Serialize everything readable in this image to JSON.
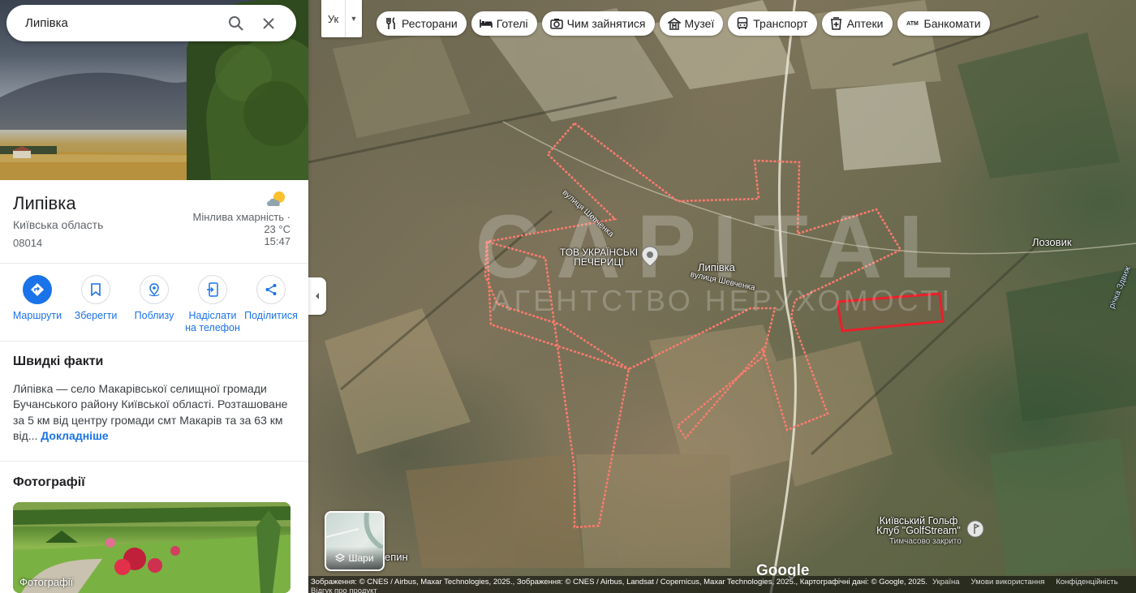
{
  "search": {
    "value": "Липівка"
  },
  "place": {
    "title": "Липівка",
    "region": "Київська область",
    "postal_code": "08014",
    "weather": {
      "condition": "Мінлива хмарність ·",
      "temperature": "23 °C",
      "time": "15:47"
    }
  },
  "actions": [
    {
      "label": "Маршрути",
      "icon": "directions-icon"
    },
    {
      "label": "Зберегти",
      "icon": "bookmark-icon"
    },
    {
      "label": "Поблизу",
      "icon": "nearby-icon"
    },
    {
      "label": "Надіслати на телефон",
      "icon": "send-to-phone-icon"
    },
    {
      "label": "Поділитися",
      "icon": "share-icon"
    }
  ],
  "quick_facts": {
    "heading": "Швидкі факти",
    "text": "Ли́півка — село Макарівської селищної громади Бучанського району Київської області. Розташоване за 5 км від центру громади смт Макарів та за 63 км від... ",
    "more": "Докладніше"
  },
  "photos": {
    "heading": "Фотографії",
    "caption": "Фотографії"
  },
  "map": {
    "language": "Ук",
    "chips": [
      {
        "label": "Ресторани",
        "icon": "restaurant-icon"
      },
      {
        "label": "Готелі",
        "icon": "hotel-icon"
      },
      {
        "label": "Чим зайнятися",
        "icon": "camera-icon"
      },
      {
        "label": "Музеї",
        "icon": "museum-icon"
      },
      {
        "label": "Транспорт",
        "icon": "transit-icon"
      },
      {
        "label": "Аптеки",
        "icon": "pharmacy-icon"
      },
      {
        "label": "Банкомати",
        "icon": "atm-icon"
      }
    ],
    "labels": {
      "village": "Липівка",
      "street_1": "вулиця Шевченка",
      "street_2": "вулиця Шевченка",
      "poi": "ТОВ УКРАЇНСЬКІ ПЕЧЕРИЦІ",
      "neighbor": "Лозовик",
      "river": "річка Здвиж",
      "golf_name": "Київський Гольф Клуб \"GolfStream\"",
      "golf_status": "Тимчасово закрито",
      "bottom_place": "епин"
    },
    "watermark": {
      "big": "CAPITAL",
      "small": "АГЕНТСТВО НЕРУХОМОСТІ"
    },
    "layers_label": "Шари",
    "logo": "Google",
    "attribution": "Зображення: © CNES / Airbus, Maxar Technologies, 2025., Зображення: © CNES / Airbus, Landsat / Copernicus, Maxar Technologies, 2025., Картографічні дані: © Google, 2025.",
    "feedback": "Відгук про продукт",
    "links": [
      "Україна",
      "Умови використання",
      "Конфіденційність"
    ],
    "colors": {
      "boundary": "#ff6f61",
      "highlight": "#e8202a",
      "accent": "#1a73e8"
    }
  }
}
